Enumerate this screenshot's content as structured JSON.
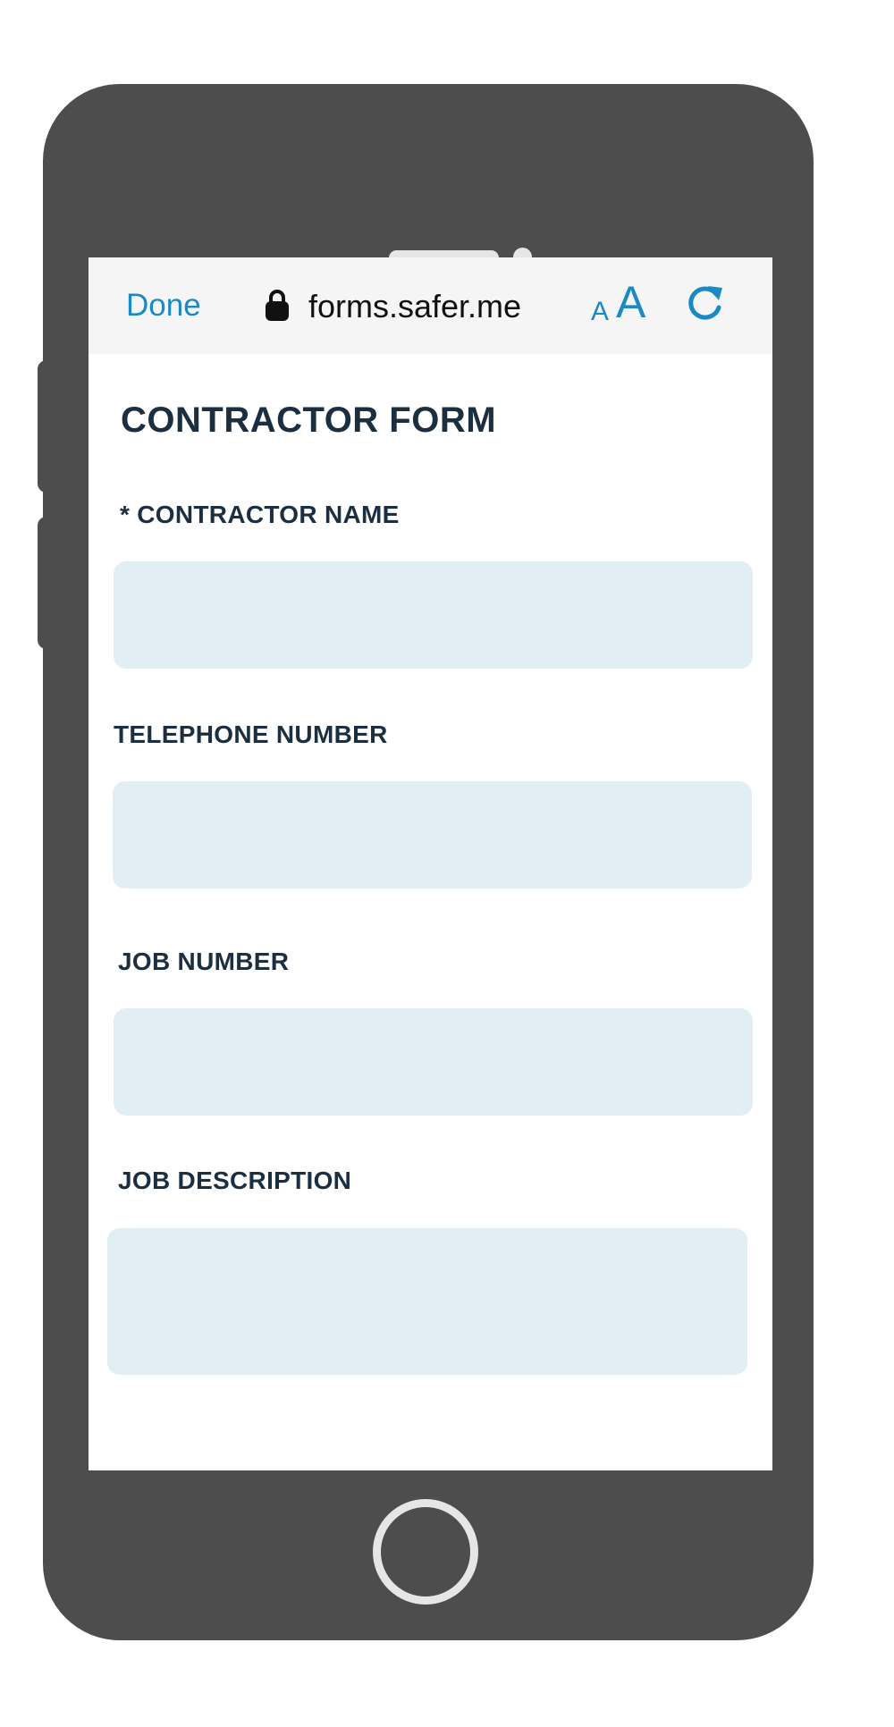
{
  "browser": {
    "done_label": "Done",
    "url": "forms.safer.me",
    "text_size_small": "A",
    "text_size_large": "A",
    "icons": {
      "lock": "lock-icon",
      "reload": "reload-icon"
    }
  },
  "form": {
    "title": "CONTRACTOR FORM",
    "fields": [
      {
        "label": "* CONTRACTOR NAME",
        "value": "",
        "placeholder": ""
      },
      {
        "label": "TELEPHONE NUMBER",
        "value": "",
        "placeholder": ""
      },
      {
        "label": "JOB NUMBER",
        "value": "",
        "placeholder": ""
      },
      {
        "label": "JOB DESCRIPTION",
        "value": "",
        "placeholder": ""
      }
    ]
  },
  "colors": {
    "accent": "#1b8ac4",
    "heading": "#1b2f40",
    "field_bg": "#e1eef4",
    "device": "#4d4d4d"
  }
}
